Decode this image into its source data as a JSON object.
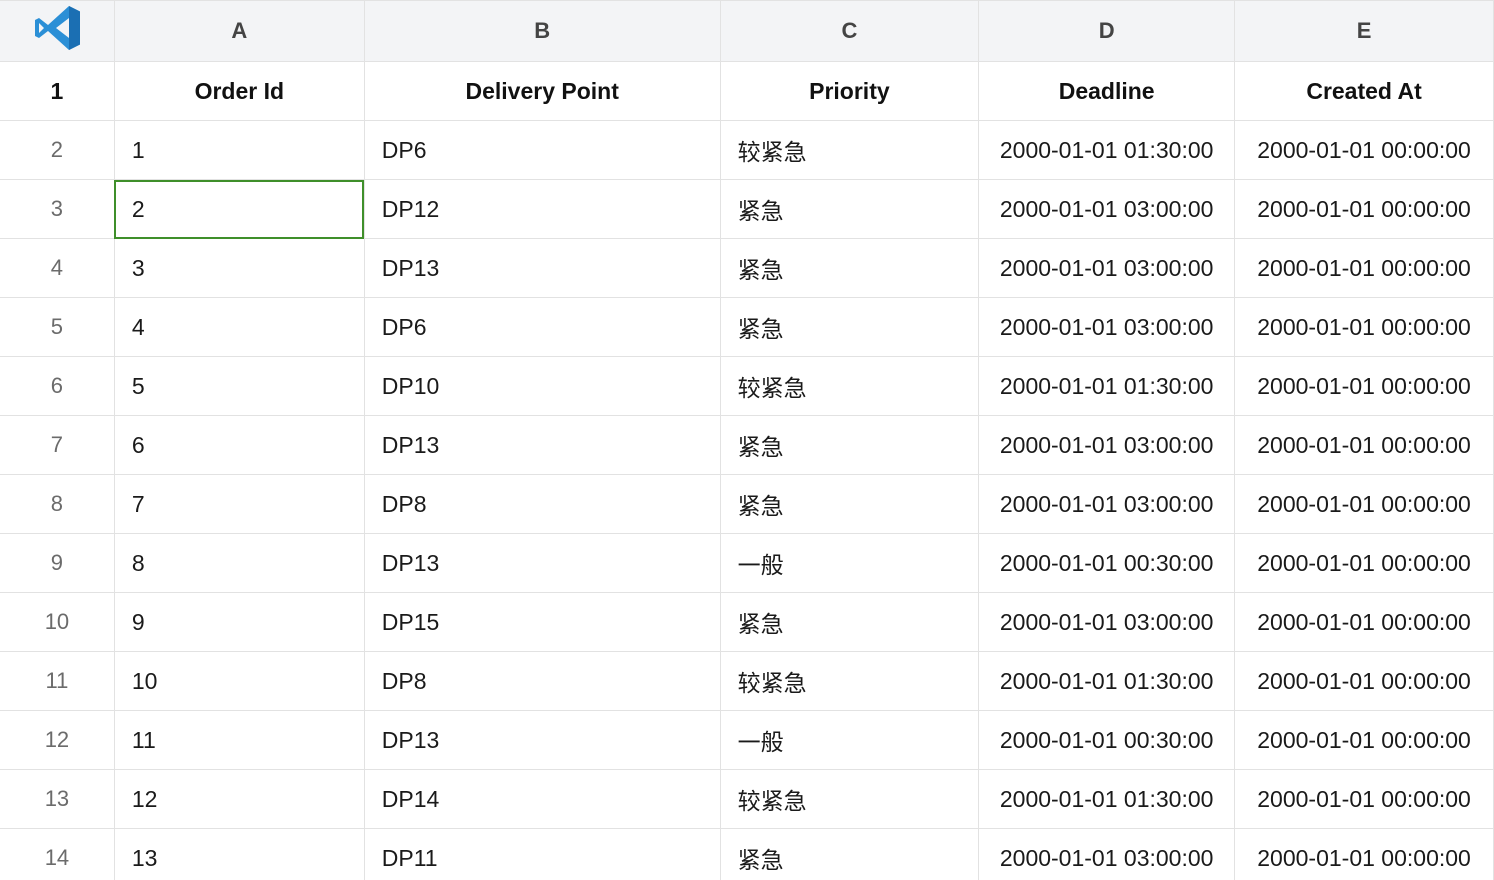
{
  "column_letters": [
    "A",
    "B",
    "C",
    "D",
    "E"
  ],
  "header_row": {
    "row_number": "1",
    "cells": [
      "Order Id",
      "Delivery Point",
      "Priority",
      "Deadline",
      "Created At"
    ]
  },
  "rows": [
    {
      "row_number": "2",
      "cells": [
        "1",
        "DP6",
        "较紧急",
        "2000-01-01 01:30:00",
        "2000-01-01 00:00:00"
      ]
    },
    {
      "row_number": "3",
      "cells": [
        "2",
        "DP12",
        "紧急",
        "2000-01-01 03:00:00",
        "2000-01-01 00:00:00"
      ]
    },
    {
      "row_number": "4",
      "cells": [
        "3",
        "DP13",
        "紧急",
        "2000-01-01 03:00:00",
        "2000-01-01 00:00:00"
      ]
    },
    {
      "row_number": "5",
      "cells": [
        "4",
        "DP6",
        "紧急",
        "2000-01-01 03:00:00",
        "2000-01-01 00:00:00"
      ]
    },
    {
      "row_number": "6",
      "cells": [
        "5",
        "DP10",
        "较紧急",
        "2000-01-01 01:30:00",
        "2000-01-01 00:00:00"
      ]
    },
    {
      "row_number": "7",
      "cells": [
        "6",
        "DP13",
        "紧急",
        "2000-01-01 03:00:00",
        "2000-01-01 00:00:00"
      ]
    },
    {
      "row_number": "8",
      "cells": [
        "7",
        "DP8",
        "紧急",
        "2000-01-01 03:00:00",
        "2000-01-01 00:00:00"
      ]
    },
    {
      "row_number": "9",
      "cells": [
        "8",
        "DP13",
        "一般",
        "2000-01-01 00:30:00",
        "2000-01-01 00:00:00"
      ]
    },
    {
      "row_number": "10",
      "cells": [
        "9",
        "DP15",
        "紧急",
        "2000-01-01 03:00:00",
        "2000-01-01 00:00:00"
      ]
    },
    {
      "row_number": "11",
      "cells": [
        "10",
        "DP8",
        "较紧急",
        "2000-01-01 01:30:00",
        "2000-01-01 00:00:00"
      ]
    },
    {
      "row_number": "12",
      "cells": [
        "11",
        "DP13",
        "一般",
        "2000-01-01 00:30:00",
        "2000-01-01 00:00:00"
      ]
    },
    {
      "row_number": "13",
      "cells": [
        "12",
        "DP14",
        "较紧急",
        "2000-01-01 01:30:00",
        "2000-01-01 00:00:00"
      ]
    },
    {
      "row_number": "14",
      "cells": [
        "13",
        "DP11",
        "紧急",
        "2000-01-01 03:00:00",
        "2000-01-01 00:00:00"
      ]
    }
  ],
  "selected_cell": "A3",
  "colors": {
    "selection_border": "#3f8f2a",
    "logo_blue": "#2b8fd6",
    "header_bg": "#f3f4f6"
  },
  "logo_icon": "vscode-logo-icon"
}
